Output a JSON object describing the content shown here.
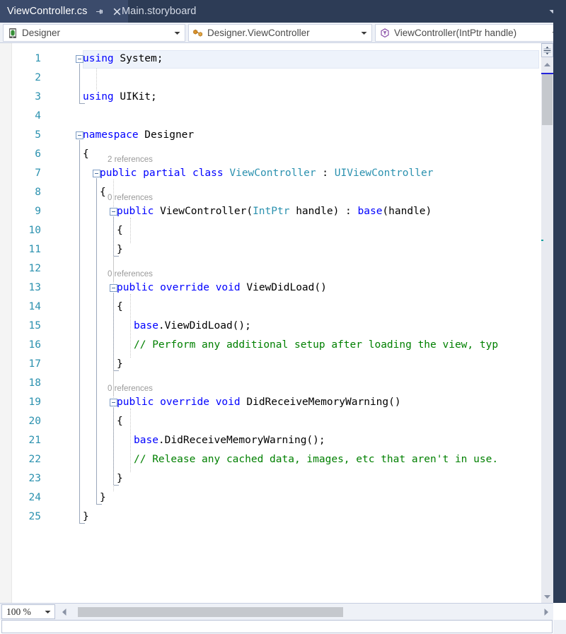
{
  "window": {
    "tab_bar": {
      "tabs": [
        {
          "label": "ViewController.cs",
          "active": true
        },
        {
          "label": "Main.storyboard",
          "active": false
        }
      ],
      "pin_icon": "pin-icon",
      "close_icon": "close-icon",
      "overflow_icon": "chevron-down-icon"
    },
    "nav_bar": {
      "project_combo": {
        "value": "Designer",
        "icon": "device-icon"
      },
      "class_combo": {
        "value": "Designer.ViewController",
        "icon": "class-icon"
      },
      "member_combo": {
        "value": "ViewController(IntPtr handle)",
        "icon": "method-icon"
      },
      "dropdown_icon": "chevron-down-icon"
    },
    "editor": {
      "language": "csharp",
      "current_line": 1,
      "colors": {
        "keyword": "#0000ff",
        "type": "#2b91af",
        "comment": "#008000",
        "plain": "#000000",
        "line_number": "#2b91af",
        "codelens": "#9a9a9a",
        "current_line_bg": "#eef3fb"
      },
      "line_numbers": [
        1,
        2,
        3,
        4,
        5,
        6,
        7,
        8,
        9,
        10,
        11,
        12,
        13,
        14,
        15,
        16,
        17,
        18,
        19,
        20,
        21,
        22,
        23,
        24,
        25
      ],
      "lines": [
        {
          "n": 1,
          "indent": 0,
          "tokens": [
            {
              "t": "using",
              "c": "kw"
            },
            {
              "t": " System;",
              "c": "pln"
            }
          ]
        },
        {
          "n": 2,
          "indent": 0,
          "tokens": []
        },
        {
          "n": 3,
          "indent": 0,
          "tokens": [
            {
              "t": "using",
              "c": "kw"
            },
            {
              "t": " UIKit;",
              "c": "pln"
            }
          ]
        },
        {
          "n": 4,
          "indent": 0,
          "tokens": []
        },
        {
          "n": 5,
          "indent": 0,
          "tokens": [
            {
              "t": "namespace",
              "c": "kw"
            },
            {
              "t": " Designer",
              "c": "pln"
            }
          ]
        },
        {
          "n": 6,
          "indent": 0,
          "tokens": [
            {
              "t": "{",
              "c": "pln"
            }
          ]
        },
        {
          "n": 7,
          "indent": 1,
          "tokens": [
            {
              "t": "public",
              "c": "kw"
            },
            {
              "t": " ",
              "c": "pln"
            },
            {
              "t": "partial",
              "c": "kw"
            },
            {
              "t": " ",
              "c": "pln"
            },
            {
              "t": "class",
              "c": "kw"
            },
            {
              "t": " ",
              "c": "pln"
            },
            {
              "t": "ViewController",
              "c": "typ"
            },
            {
              "t": " : ",
              "c": "pln"
            },
            {
              "t": "UIViewController",
              "c": "typ"
            }
          ]
        },
        {
          "n": 8,
          "indent": 1,
          "tokens": [
            {
              "t": "{",
              "c": "pln"
            }
          ]
        },
        {
          "n": 9,
          "indent": 2,
          "tokens": [
            {
              "t": "public",
              "c": "kw"
            },
            {
              "t": " ViewController(",
              "c": "pln"
            },
            {
              "t": "IntPtr",
              "c": "typ"
            },
            {
              "t": " handle) : ",
              "c": "pln"
            },
            {
              "t": "base",
              "c": "kw"
            },
            {
              "t": "(handle)",
              "c": "pln"
            }
          ]
        },
        {
          "n": 10,
          "indent": 2,
          "tokens": [
            {
              "t": "{",
              "c": "pln"
            }
          ]
        },
        {
          "n": 11,
          "indent": 2,
          "tokens": [
            {
              "t": "}",
              "c": "pln"
            }
          ]
        },
        {
          "n": 12,
          "indent": 0,
          "tokens": []
        },
        {
          "n": 13,
          "indent": 2,
          "tokens": [
            {
              "t": "public",
              "c": "kw"
            },
            {
              "t": " ",
              "c": "pln"
            },
            {
              "t": "override",
              "c": "kw"
            },
            {
              "t": " ",
              "c": "pln"
            },
            {
              "t": "void",
              "c": "kw"
            },
            {
              "t": " ViewDidLoad()",
              "c": "pln"
            }
          ]
        },
        {
          "n": 14,
          "indent": 2,
          "tokens": [
            {
              "t": "{",
              "c": "pln"
            }
          ]
        },
        {
          "n": 15,
          "indent": 3,
          "tokens": [
            {
              "t": "base",
              "c": "kw"
            },
            {
              "t": ".ViewDidLoad();",
              "c": "pln"
            }
          ]
        },
        {
          "n": 16,
          "indent": 3,
          "tokens": [
            {
              "t": "// Perform any additional setup after loading the view, typ",
              "c": "cmt"
            }
          ]
        },
        {
          "n": 17,
          "indent": 2,
          "tokens": [
            {
              "t": "}",
              "c": "pln"
            }
          ]
        },
        {
          "n": 18,
          "indent": 0,
          "tokens": []
        },
        {
          "n": 19,
          "indent": 2,
          "tokens": [
            {
              "t": "public",
              "c": "kw"
            },
            {
              "t": " ",
              "c": "pln"
            },
            {
              "t": "override",
              "c": "kw"
            },
            {
              "t": " ",
              "c": "pln"
            },
            {
              "t": "void",
              "c": "kw"
            },
            {
              "t": " DidReceiveMemoryWarning()",
              "c": "pln"
            }
          ]
        },
        {
          "n": 20,
          "indent": 2,
          "tokens": [
            {
              "t": "{",
              "c": "pln"
            }
          ]
        },
        {
          "n": 21,
          "indent": 3,
          "tokens": [
            {
              "t": "base",
              "c": "kw"
            },
            {
              "t": ".DidReceiveMemoryWarning();",
              "c": "pln"
            }
          ]
        },
        {
          "n": 22,
          "indent": 3,
          "tokens": [
            {
              "t": "// Release any cached data, images, etc that aren't in use.",
              "c": "cmt"
            }
          ]
        },
        {
          "n": 23,
          "indent": 2,
          "tokens": [
            {
              "t": "}",
              "c": "pln"
            }
          ]
        },
        {
          "n": 24,
          "indent": 1,
          "tokens": [
            {
              "t": "}",
              "c": "pln"
            }
          ]
        },
        {
          "n": 25,
          "indent": 0,
          "tokens": [
            {
              "t": "}",
              "c": "pln"
            }
          ]
        }
      ],
      "codelens": [
        {
          "label": "2 references",
          "for_line": 7
        },
        {
          "label": "0 references",
          "for_line": 9
        },
        {
          "label": "0 references",
          "for_line": 13
        },
        {
          "label": "0 references",
          "for_line": 19
        }
      ],
      "outlining_collapse_lines": [
        1,
        5,
        7,
        9,
        13,
        19
      ]
    },
    "vertical_scrollbar": {
      "split_view_icon": "split-view-icon",
      "up_arrow_icon": "chevron-up-icon",
      "down_arrow_icon": "chevron-down-icon",
      "caret_marker_color": "#2323dc",
      "change_tick_color": "#12a0a0"
    },
    "bottom_bar": {
      "zoom_level": "100 %",
      "zoom_dropdown_icon": "chevron-down-icon",
      "scroll_left_icon": "triangle-left-icon",
      "scroll_right_icon": "triangle-right-icon"
    }
  }
}
